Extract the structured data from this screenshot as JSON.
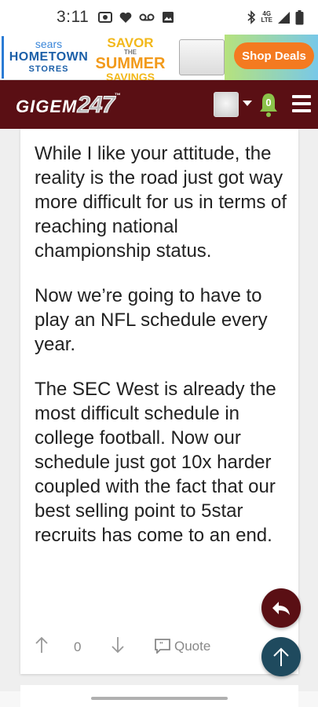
{
  "status_bar": {
    "time": "3:11",
    "network": "4G",
    "network_sub": "LTE"
  },
  "ad": {
    "sears_line1": "sears",
    "sears_line2": "HOMETOWN",
    "sears_line3": "STORES",
    "savor_line1": "SAVOR",
    "savor_line2": "THE",
    "savor_line3": "SUMMER",
    "savor_line4": "SAVINGS",
    "cta": "Shop Deals"
  },
  "header": {
    "logo_text": "GIGEM",
    "logo_number": "247",
    "logo_tm": "™",
    "notification_count": "0"
  },
  "post": {
    "paragraphs": [
      "While I like your attitude, the reality is the road just got way more difficult for us in terms of reaching national championship status.",
      "Now we’re going to have to play an NFL schedule every year.",
      "The SEC West is already the most difficult schedule in college football. Now our schedule just got 10x harder coupled with the fact that our best selling point to 5star recruits has come to an end."
    ],
    "vote_count": "0",
    "quote_label": "Quote"
  },
  "colors": {
    "header_bg": "#5a0f14",
    "reply_fab": "#5a0f14",
    "scroll_top_fab": "#1f4a5e",
    "bell": "#8bc34a",
    "cta": "#f47a20"
  },
  "icons": [
    "photo-icon",
    "heart-icon",
    "voicemail-icon",
    "image-icon",
    "bluetooth-icon",
    "signal-icon",
    "battery-icon",
    "bell-icon",
    "menu-icon",
    "up-arrow-icon",
    "down-arrow-icon",
    "quote-icon",
    "reply-icon",
    "arrow-up-icon"
  ]
}
